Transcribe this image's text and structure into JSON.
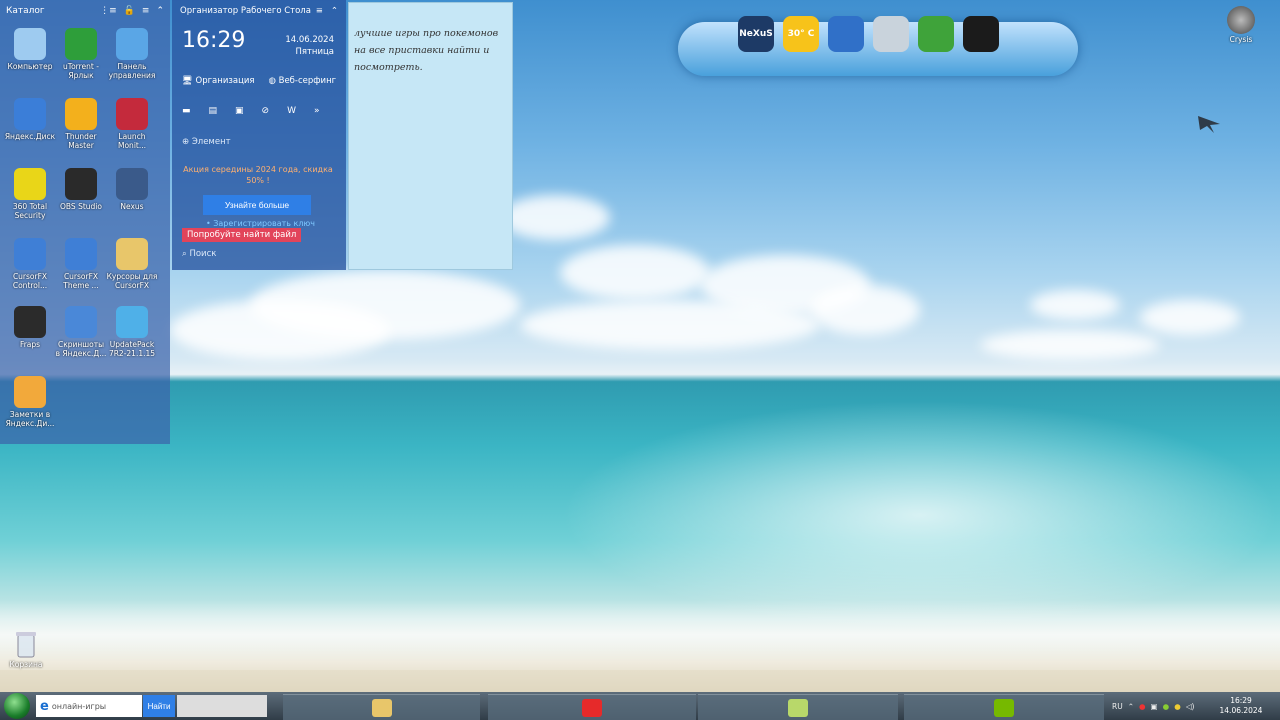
{
  "catalog": {
    "title": "Каталог",
    "icons": [
      {
        "label": "Компьютер",
        "icon": "computer-icon",
        "color": "#9ecbf0"
      },
      {
        "label": "uTorrent - Ярлык",
        "icon": "utorrent-icon",
        "color": "#2e9e3a"
      },
      {
        "label": "Панель управления",
        "icon": "control-panel-icon",
        "color": "#5aa6e6"
      },
      {
        "label": "Яндекс.Диск",
        "icon": "yandex-disk-icon",
        "color": "#3b7ed8"
      },
      {
        "label": "Thunder Master",
        "icon": "thunder-master-icon",
        "color": "#f3b01c"
      },
      {
        "label": "Launch Monit...",
        "icon": "launch-monitor-icon",
        "color": "#c42a3c"
      },
      {
        "label": "360 Total Security",
        "icon": "360-security-icon",
        "color": "#e9d618"
      },
      {
        "label": "OBS Studio",
        "icon": "obs-icon",
        "color": "#2a2a2a"
      },
      {
        "label": "Nexus",
        "icon": "nexus-icon",
        "color": "#3a5a8a"
      },
      {
        "label": "CursorFX Control...",
        "icon": "cursorfx-icon",
        "color": "#3f7fd6"
      },
      {
        "label": "CursorFX Theme ...",
        "icon": "cursorfx-theme-icon",
        "color": "#3f7fd6"
      },
      {
        "label": "Курсоры для CursorFX",
        "icon": "folder-icon",
        "color": "#e8c66a"
      },
      {
        "label": "Fraps",
        "icon": "fraps-icon",
        "color": "#2b2b2b"
      },
      {
        "label": "Скриншоты в Яндекс.Д...",
        "icon": "screenshots-icon",
        "color": "#4a88d8"
      },
      {
        "label": "UpdatePack 7R2-21.1.15",
        "icon": "updatepack-icon",
        "color": "#4fb0e8"
      },
      {
        "label": "Заметки в Яндекс.Ди...",
        "icon": "notes-icon",
        "color": "#f2a93b"
      }
    ]
  },
  "organizer": {
    "title": "Организатор Рабочего Стола",
    "time": "16:29",
    "date": "14.06.2024",
    "weekday": "Пятница",
    "link_org": "Организация",
    "link_web": "Веб-серфинг",
    "add_element": "Элемент",
    "promo": "Акция середины 2024 года, скидка 50% !",
    "learn_more": "Узнайте больше",
    "register_key": "• Зарегистрировать ключ",
    "try_find": "Попробуйте найти файл",
    "search": "Поиск"
  },
  "note": {
    "text": "лучшие игры про покемонов на все приставки найти и посмотреть."
  },
  "dock": {
    "items": [
      {
        "label": "NeXuS",
        "icon": "nexus-logo-icon",
        "color": "#1d3a66"
      },
      {
        "label": "30° C",
        "icon": "weather-sun-icon",
        "color": "#f7c31a"
      },
      {
        "label": "",
        "icon": "computer-icon",
        "color": "#3070c8"
      },
      {
        "label": "",
        "icon": "speaker-icon",
        "color": "#c9d3dc"
      },
      {
        "label": "",
        "icon": "battery-icon",
        "color": "#3fa33a"
      },
      {
        "label": "",
        "icon": "camera-icon",
        "color": "#1b1b1b"
      }
    ]
  },
  "desktop": {
    "crysis_label": "Crysis",
    "recycle_label": "Корзина"
  },
  "taskbar": {
    "search_text": "онлайн-игры",
    "search_button": "Найти",
    "lang": "RU",
    "time": "16:29",
    "date": "14.06.2024",
    "apps": [
      {
        "icon": "explorer-folder-icon",
        "color": "#e8c66a"
      },
      {
        "icon": "yandex-browser-icon",
        "color": "#e62a2a"
      },
      {
        "icon": "notes-app-icon",
        "color": "#b8d86a"
      },
      {
        "icon": "nvidia-icon",
        "color": "#76b900"
      }
    ]
  }
}
